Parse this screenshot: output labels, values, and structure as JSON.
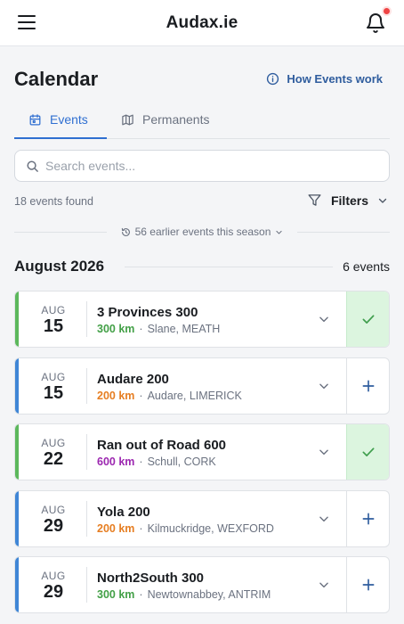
{
  "header": {
    "title": "Audax.ie",
    "menu_icon": "hamburger-icon",
    "bell_icon": "bell-icon"
  },
  "page": {
    "title": "Calendar",
    "how_events_link": "How Events work"
  },
  "tabs": [
    {
      "label": "Events",
      "icon": "calendar-icon",
      "active": true
    },
    {
      "label": "Permanents",
      "icon": "map-icon",
      "active": false
    }
  ],
  "search": {
    "placeholder": "Search events...",
    "value": ""
  },
  "results": {
    "count_text": "18 events found",
    "filters_label": "Filters"
  },
  "earlier": {
    "label": "56 earlier events this season"
  },
  "month": {
    "title": "August 2026",
    "count": "6 events"
  },
  "colors": {
    "accent": "#2f6fd1",
    "registered": "#5cb85c",
    "open": "#3f86d6",
    "green_km": "#43a047",
    "orange_km": "#e67e22",
    "purple_km": "#9c27b0"
  },
  "events": [
    {
      "month": "AUG",
      "day": "15",
      "name": "3 Provinces 300",
      "distance": "300 km",
      "location": "Slane, MEATH",
      "status": "registered",
      "km_color": "#43a047",
      "stripe": "#5cb85c"
    },
    {
      "month": "AUG",
      "day": "15",
      "name": "Audare 200",
      "distance": "200 km",
      "location": "Audare, LIMERICK",
      "status": "open",
      "km_color": "#e67e22",
      "stripe": "#3f86d6"
    },
    {
      "month": "AUG",
      "day": "22",
      "name": "Ran out of Road 600",
      "distance": "600 km",
      "location": "Schull, CORK",
      "status": "registered",
      "km_color": "#9c27b0",
      "stripe": "#5cb85c"
    },
    {
      "month": "AUG",
      "day": "29",
      "name": "Yola 200",
      "distance": "200 km",
      "location": "Kilmuckridge, WEXFORD",
      "status": "open",
      "km_color": "#e67e22",
      "stripe": "#3f86d6"
    },
    {
      "month": "AUG",
      "day": "29",
      "name": "North2South 300",
      "distance": "300 km",
      "location": "Newtownabbey, ANTRIM",
      "status": "open",
      "km_color": "#43a047",
      "stripe": "#3f86d6"
    }
  ]
}
